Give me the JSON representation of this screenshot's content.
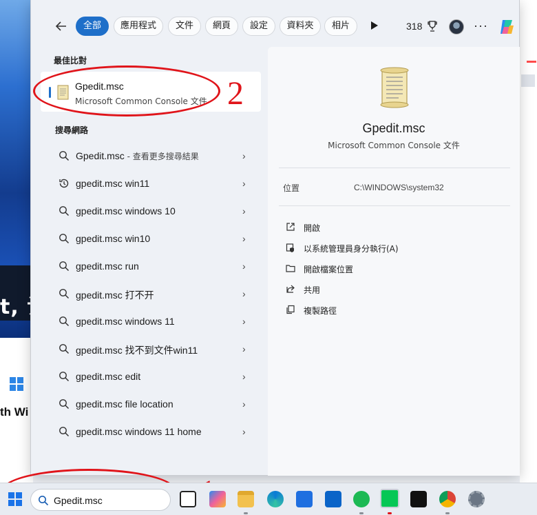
{
  "tabs": [
    {
      "label": "全部",
      "active": true
    },
    {
      "label": "應用程式"
    },
    {
      "label": "文件"
    },
    {
      "label": "網頁"
    },
    {
      "label": "設定"
    },
    {
      "label": "資料夾"
    },
    {
      "label": "相片"
    }
  ],
  "header": {
    "points": "318"
  },
  "best_match": {
    "section_label": "最佳比對",
    "title": "Gpedit.msc",
    "subtitle": "Microsoft Common Console 文件"
  },
  "web": {
    "section_label": "搜尋網路",
    "items": [
      {
        "text": "Gpedit.msc",
        "hint": " - 查看更多搜尋結果",
        "icon": "search-icon"
      },
      {
        "text": "gpedit.msc win11",
        "icon": "history-icon"
      },
      {
        "text": "gpedit.msc windows 10",
        "icon": "search-icon"
      },
      {
        "text": "gpedit.msc win10",
        "icon": "search-icon"
      },
      {
        "text": "gpedit.msc run",
        "icon": "search-icon"
      },
      {
        "text": "gpedit.msc 打不开",
        "icon": "search-icon"
      },
      {
        "text": "gpedit.msc windows 11",
        "icon": "search-icon"
      },
      {
        "text": "gpedit.msc 找不到文件win11",
        "icon": "search-icon"
      },
      {
        "text": "gpedit.msc edit",
        "icon": "search-icon"
      },
      {
        "text": "gpedit.msc file location",
        "icon": "search-icon"
      },
      {
        "text": "gpedit.msc windows 11 home",
        "icon": "search-icon"
      }
    ]
  },
  "preview": {
    "title": "Gpedit.msc",
    "subtitle": "Microsoft Common Console 文件",
    "location_label": "位置",
    "location_value": "C:\\WINDOWS\\system32",
    "actions": [
      {
        "label": "開啟",
        "icon": "open-icon"
      },
      {
        "label": "以系統管理員身分執行(A)",
        "icon": "admin-shield-icon"
      },
      {
        "label": "開啟檔案位置",
        "icon": "folder-icon"
      },
      {
        "label": "共用",
        "icon": "share-icon"
      },
      {
        "label": "複製路徑",
        "icon": "copy-icon"
      }
    ]
  },
  "taskbar": {
    "search_text": "Gpedit.msc",
    "apps": [
      "task-view-icon",
      "copilot-app-icon",
      "file-explorer-icon",
      "edge-icon",
      "store-icon",
      "outlook-icon",
      "spotify-icon",
      "line-icon",
      "id-app-icon",
      "chrome-icon",
      "settings-icon"
    ]
  },
  "annotations": {
    "marker1": "1",
    "marker2": "2"
  },
  "background": {
    "big_text": "t, 让",
    "small_text": "th Wi"
  },
  "colors": {
    "accent": "#1e6fc9",
    "annotation": "#e0141a"
  }
}
